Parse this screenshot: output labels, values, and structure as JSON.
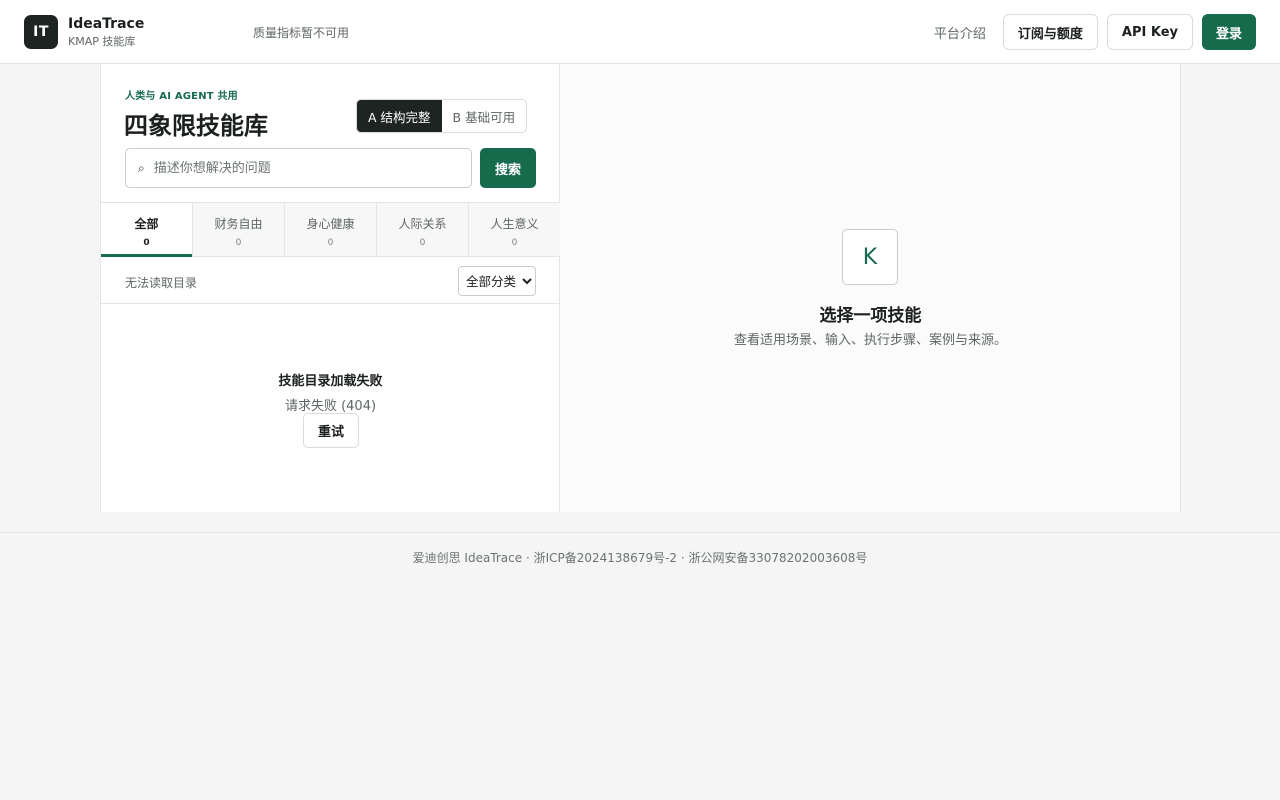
{
  "header": {
    "logo_text": "IT",
    "brand_name": "IdeaTrace",
    "brand_sub": "KMAP 技能库",
    "quality_note": "质量指标暂不可用",
    "nav": {
      "intro": "平台介绍",
      "subscription": "订阅与额度",
      "api_key": "API Key",
      "login": "登录"
    }
  },
  "left_panel": {
    "kicker": "人类与 AI AGENT 共用",
    "title": "四象限技能库",
    "segments": [
      {
        "label": "A 结构完整",
        "active": true
      },
      {
        "label": "B 基础可用",
        "active": false
      }
    ],
    "search": {
      "icon": "search-icon",
      "placeholder": "描述你想解决的问题",
      "value": "",
      "button": "搜索"
    },
    "tabs": [
      {
        "label": "全部",
        "count": "0",
        "active": true
      },
      {
        "label": "财务自由",
        "count": "0",
        "active": false
      },
      {
        "label": "身心健康",
        "count": "0",
        "active": false
      },
      {
        "label": "人际关系",
        "count": "0",
        "active": false
      },
      {
        "label": "人生意义",
        "count": "0",
        "active": false
      }
    ],
    "catalog_status": "无法读取目录",
    "category_select": {
      "selected": "全部分类"
    },
    "error": {
      "title": "技能目录加载失败",
      "message": "请求失败 (404)",
      "retry": "重试"
    }
  },
  "right_panel": {
    "badge": "K",
    "title": "选择一项技能",
    "subtitle": "查看适用场景、输入、执行步骤、案例与来源。"
  },
  "footer": {
    "text": "爱迪创思 IdeaTrace · 浙ICP备2024138679号-2 · 浙公网安备33078202003608号"
  },
  "colors": {
    "brand_green": "#176b4d",
    "dark": "#1d2421",
    "background": "#f4f5f4"
  }
}
